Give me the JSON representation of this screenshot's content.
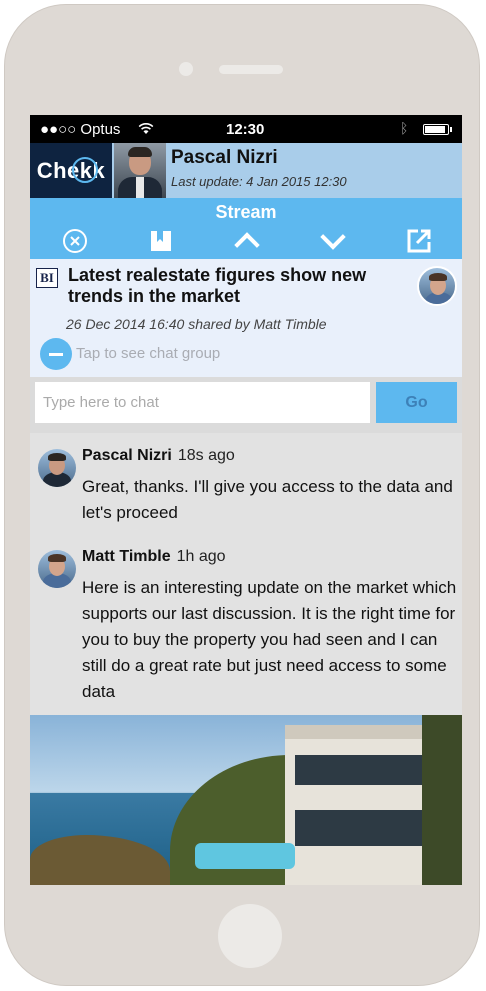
{
  "status_bar": {
    "carrier": "●●○○ Optus",
    "time": "12:30"
  },
  "header": {
    "logo": "Chekk",
    "user_name": "Pascal Nizri",
    "last_update": "Last update: 4 Jan 2015 12:30"
  },
  "toolbar": {
    "title": "Stream",
    "icons": [
      "close-circle-icon",
      "bookmark-icon",
      "chevron-up-icon",
      "chevron-down-icon",
      "share-icon"
    ]
  },
  "article": {
    "source_badge": "BI",
    "title": "Latest realestate figures show new trends in the market",
    "meta": "26 Dec 2014 16:40 shared by Matt Timble",
    "chat_group_hint": "Tap to see chat group"
  },
  "chat_input": {
    "placeholder": "Type here to chat",
    "go_label": "Go"
  },
  "messages": [
    {
      "author": "Pascal Nizri",
      "time_ago": "18s ago",
      "text": "Great, thanks. I'll give you access to the data and let's proceed"
    },
    {
      "author": "Matt Timble",
      "time_ago": "1h ago",
      "text": "Here is an interesting update on the market which supports our last discussion. It is the right time for you to buy the property you had seen and I can still do a great rate but just need access to some data"
    }
  ],
  "colors": {
    "accent": "#5db8ef",
    "header_bg": "#a9cdea",
    "logo_bg": "#0e2340"
  }
}
